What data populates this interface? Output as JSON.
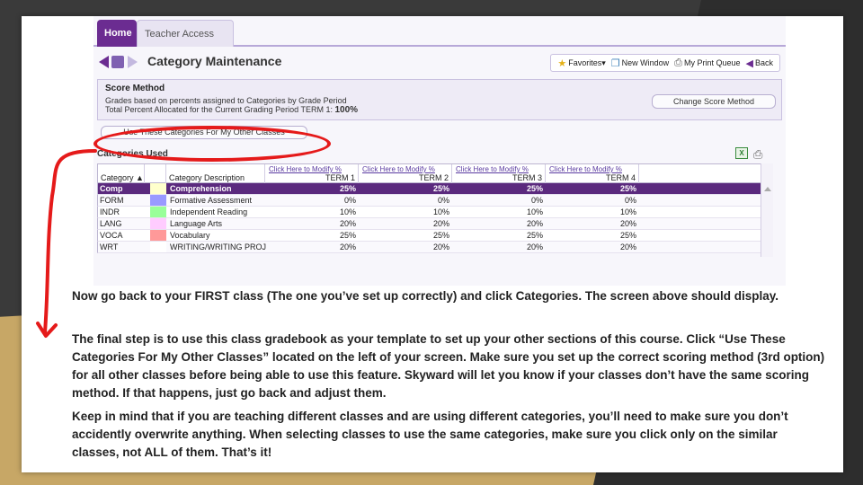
{
  "tabs": [
    {
      "label": "Home"
    },
    {
      "label": "Teacher Access"
    }
  ],
  "title": "Category Maintenance",
  "toolbar": {
    "favorites": "Favorites",
    "new_window": "New Window",
    "print_queue": "My Print Queue",
    "back": "Back"
  },
  "score_method": {
    "heading": "Score Method",
    "line1": "Grades based on percents assigned to Categories by Grade Period",
    "line2_prefix": "Total Percent Allocated for the Current Grading Period TERM 1: ",
    "line2_value": "100%",
    "change_button": "Change Score Method"
  },
  "use_categories_button": "Use These Categories For My Other Classes",
  "categories_used_label": "Categories Used",
  "grid": {
    "col_category": "Category ▲",
    "col_description": "Category Description",
    "modify_link": "Click Here to Modify %",
    "terms": [
      "TERM 1",
      "TERM 2",
      "TERM 3",
      "TERM 4"
    ],
    "rows": [
      {
        "code": "Comp",
        "color": "#ffffcc",
        "desc": "Comprehension",
        "values": [
          "25%",
          "25%",
          "25%",
          "25%"
        ],
        "selected": true
      },
      {
        "code": "FORM",
        "color": "#9999ff",
        "desc": "Formative Assessment",
        "values": [
          "0%",
          "0%",
          "0%",
          "0%"
        ],
        "selected": false
      },
      {
        "code": "INDR",
        "color": "#99ff99",
        "desc": "Independent Reading",
        "values": [
          "10%",
          "10%",
          "10%",
          "10%"
        ],
        "selected": false
      },
      {
        "code": "LANG",
        "color": "#ffccff",
        "desc": "Language Arts",
        "values": [
          "20%",
          "20%",
          "20%",
          "20%"
        ],
        "selected": false
      },
      {
        "code": "VOCA",
        "color": "#ff9999",
        "desc": "Vocabulary",
        "values": [
          "25%",
          "25%",
          "25%",
          "25%"
        ],
        "selected": false
      },
      {
        "code": "WRT",
        "color": "#ffffff",
        "desc": "WRITING/WRITING PROJ",
        "values": [
          "20%",
          "20%",
          "20%",
          "20%"
        ],
        "selected": false
      }
    ]
  },
  "instructions": {
    "p1": "Now go back to your FIRST class (The one you’ve set up correctly) and click Categories. The screen above should display.",
    "p2": "The final step is to use this class gradebook as your template to set up your other sections of this course. Click “Use These Categories For My Other Classes” located on the left of your screen. Make sure you set up the correct scoring method (3rd option) for all other classes before being able to use this feature. Skyward will let you know if your classes don’t have the same scoring method.  If that happens, just go back and adjust them.",
    "p3": "Keep in mind that if you are teaching different classes and are using different categories, you’ll need to make sure you don’t accidently overwrite anything.  When selecting classes to use the same categories, make sure you click only on the similar classes, not ALL of them. That’s it!"
  }
}
